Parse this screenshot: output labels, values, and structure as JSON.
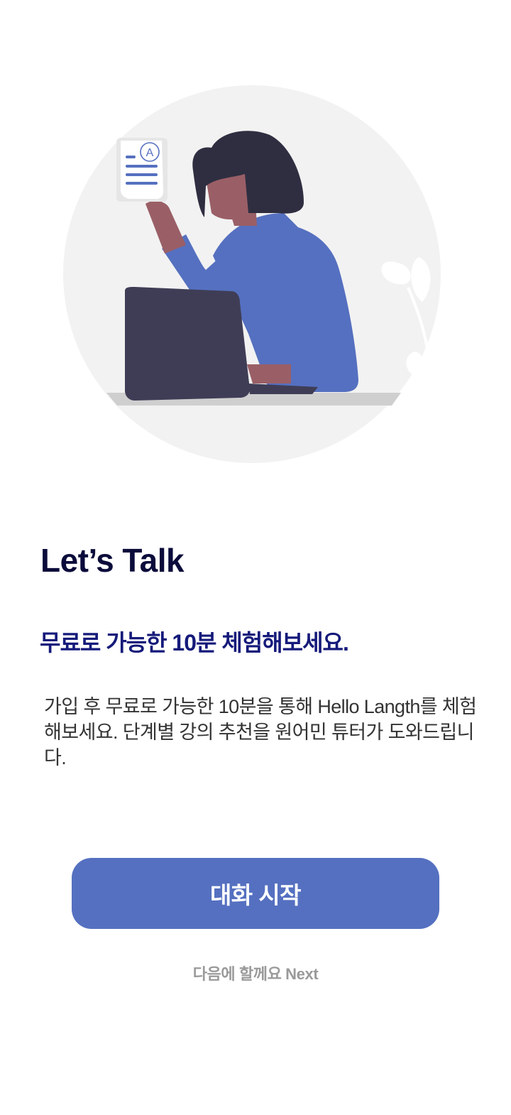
{
  "illustration": {
    "description_icon": "woman-at-laptop-illustration",
    "document_badge": "A"
  },
  "content": {
    "title": "Let’s Talk",
    "subtitle": "무료로 가능한 10분 체험해보세요.",
    "description": "가입 후 무료로 가능한 10분을 통해 Hello Langth를 체험해보세요. 단계별 강의 추천을 원어민 튜터가 도와드립니다."
  },
  "actions": {
    "start_label": "대화 시작",
    "skip_label": "다음에 할께요 Next"
  },
  "colors": {
    "primary": "#5570c0",
    "title": "#0b0b3b",
    "subtitle": "#151a7a",
    "muted": "#9a9a9a"
  }
}
